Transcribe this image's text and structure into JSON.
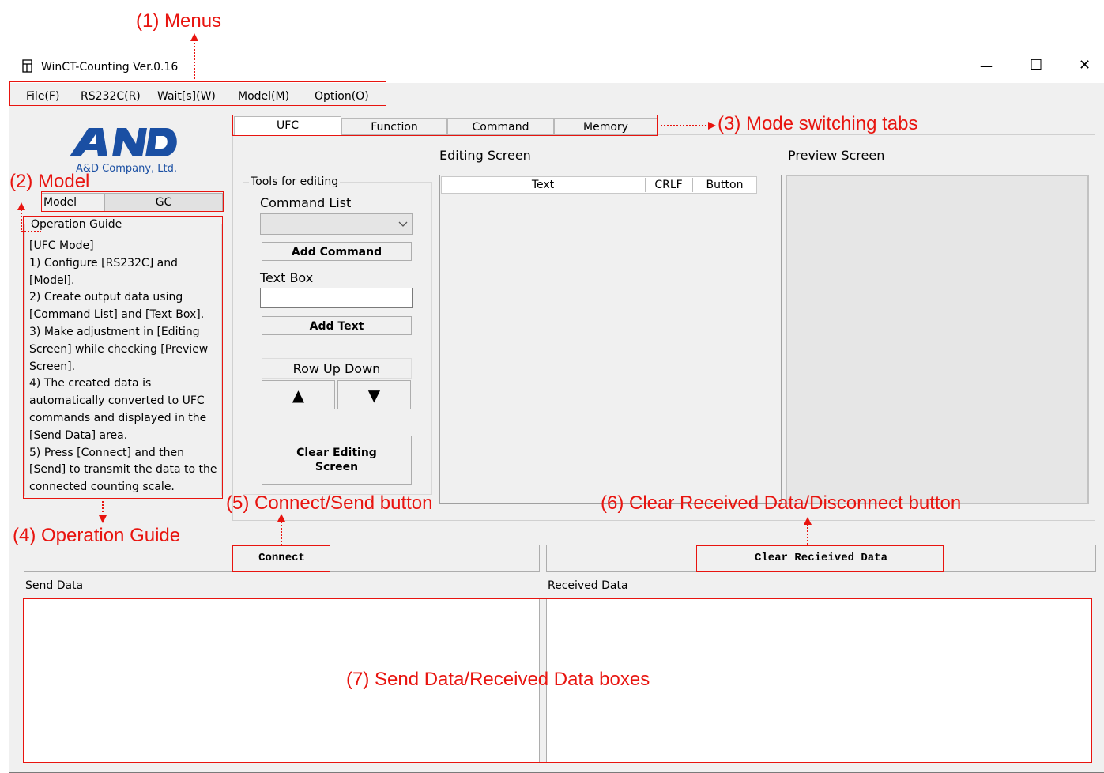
{
  "window": {
    "title": "WinCT-Counting Ver.0.16",
    "minimize": "—",
    "maximize": "☐",
    "close": "✕"
  },
  "menu": [
    {
      "label": "File(F)"
    },
    {
      "label": "RS232C(R)"
    },
    {
      "label": "Wait[s](W)"
    },
    {
      "label": "Model(M)"
    },
    {
      "label": "Option(O)"
    }
  ],
  "tabs": [
    {
      "label": "UFC"
    },
    {
      "label": "Function"
    },
    {
      "label": "Command"
    },
    {
      "label": "Memory"
    }
  ],
  "logo": {
    "mark": "AND",
    "company": "A&D Company, Ltd."
  },
  "model": {
    "label": "Model",
    "value": "GC"
  },
  "operation_guide": {
    "title": "Operation Guide",
    "text": "[UFC Mode]\n1) Configure [RS232C] and\n[Model].\n2) Create output data using\n[Command List] and [Text Box].\n3) Make adjustment in [Editing\nScreen] while checking [Preview\nScreen].\n4) The created data is\nautomatically converted to UFC\ncommands and displayed in the\n[Send Data] area.\n5) Press [Connect] and then\n[Send] to transmit the data to the\nconnected counting scale."
  },
  "tools": {
    "group_title": "Tools for editing",
    "command_list_label": "Command List",
    "add_command": "Add Command",
    "text_box_label": "Text Box",
    "text_box_value": "",
    "add_text": "Add Text",
    "row_up_down": "Row Up Down",
    "up": "▲",
    "down": "▼",
    "clear_editing": "Clear Editing Screen"
  },
  "editing": {
    "title": "Editing Screen",
    "columns": [
      "Text",
      "CRLF",
      "Button"
    ]
  },
  "preview": {
    "title": "Preview Screen"
  },
  "buttons": {
    "connect": "Connect",
    "clear_received": "Clear Recieived Data"
  },
  "send_data": {
    "label": "Send Data"
  },
  "received_data": {
    "label": "Received Data"
  },
  "annotations": {
    "menus": "(1) Menus",
    "model": "(2) Model",
    "tabs": "(3) Mode switching tabs",
    "guide": "(4) Operation Guide",
    "connect": "(5)  Connect/Send button",
    "clear": "(6) Clear Received Data/Disconnect button",
    "boxes": "(7) Send Data/Received Data boxes"
  },
  "colors": {
    "annotation": "#e8140f",
    "logo": "#1a4fa3",
    "window_bg": "#f0f0f0"
  }
}
